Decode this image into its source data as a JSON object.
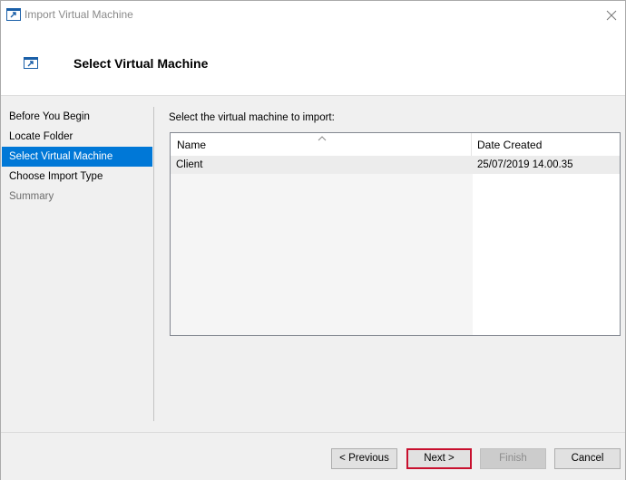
{
  "window": {
    "title": "Import Virtual Machine"
  },
  "header": {
    "title": "Select Virtual Machine"
  },
  "nav": {
    "items": [
      {
        "label": "Before You Begin",
        "state": "normal"
      },
      {
        "label": "Locate Folder",
        "state": "normal"
      },
      {
        "label": "Select Virtual Machine",
        "state": "selected"
      },
      {
        "label": "Choose Import Type",
        "state": "normal"
      },
      {
        "label": "Summary",
        "state": "disabled"
      }
    ]
  },
  "main": {
    "prompt": "Select the virtual machine to import:",
    "list": {
      "columns": [
        "Name",
        "Date Created"
      ],
      "sort_column": "Name",
      "rows": [
        {
          "name": "Client",
          "date_created": "25/07/2019 14.00.35"
        }
      ]
    }
  },
  "footer": {
    "previous_label": "< Previous",
    "next_label": "Next >",
    "finish_label": "Finish",
    "cancel_label": "Cancel"
  },
  "colors": {
    "selection": "#0078d7",
    "highlight_border": "#c8102e"
  }
}
